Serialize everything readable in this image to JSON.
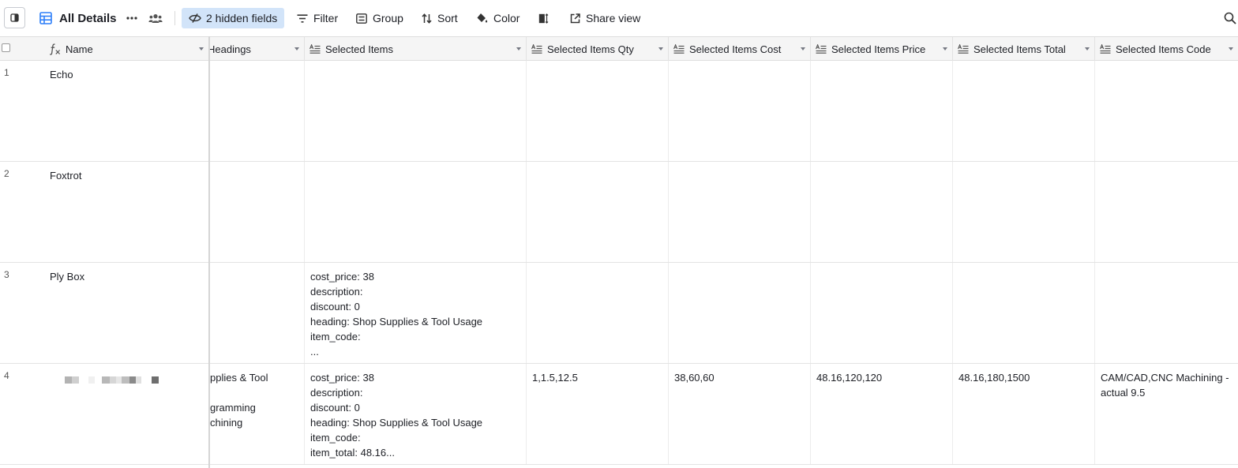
{
  "toolbar": {
    "view_name": "All Details",
    "hidden_fields": "2 hidden fields",
    "filter": "Filter",
    "group": "Group",
    "sort": "Sort",
    "color": "Color",
    "share_view": "Share view"
  },
  "columns": {
    "name": "Name",
    "headings": "Headings",
    "selected_items": "Selected Items",
    "qty": "Selected Items Qty",
    "cost": "Selected Items Cost",
    "price": "Selected Items Price",
    "total": "Selected Items Total",
    "code": "Selected Items Code"
  },
  "rows": [
    {
      "num": "1",
      "name": "Echo",
      "headings": "",
      "items": "",
      "qty": "",
      "cost": "",
      "price": "",
      "total": "",
      "code": ""
    },
    {
      "num": "2",
      "name": "Foxtrot",
      "headings": "",
      "items": "",
      "qty": "",
      "cost": "",
      "price": "",
      "total": "",
      "code": ""
    },
    {
      "num": "3",
      "name": "Ply Box",
      "headings": "",
      "items": "cost_price: 38\ndescription:\ndiscount: 0\nheading: Shop Supplies & Tool Usage\nitem_code:\n...",
      "qty": "",
      "cost": "",
      "price": "",
      "total": "",
      "code": ""
    },
    {
      "num": "4",
      "name": "",
      "headings": "pplies & Tool\n\ngramming\nchining",
      "items": "cost_price: 38\ndescription:\ndiscount: 0\nheading: Shop Supplies & Tool Usage\nitem_code:\nitem_total: 48.16...",
      "qty": "1,1.5,12.5",
      "cost": "38,60,60",
      "price": "48.16,120,120",
      "total": "48.16,180,1500",
      "code": "CAM/CAD,CNC Machining - actual 9.5"
    }
  ],
  "colors": {
    "accent": "#2d7ff9",
    "hidden_fields_bg": "#d2e4f9",
    "header_bg": "#f5f5f5"
  }
}
